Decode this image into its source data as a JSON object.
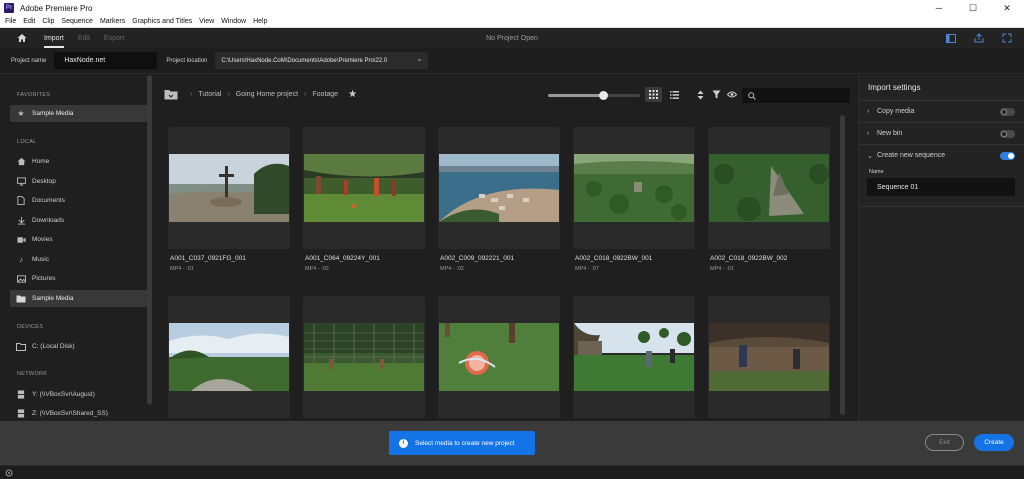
{
  "window": {
    "app_icon": "Pr",
    "title": "Adobe Premiere Pro",
    "controls": [
      "─",
      "☐",
      "✕"
    ]
  },
  "menu": [
    "File",
    "Edit",
    "Clip",
    "Sequence",
    "Markers",
    "Graphics and Titles",
    "View",
    "Window",
    "Help"
  ],
  "header": {
    "tabs": [
      "Import",
      "Edit",
      "Export"
    ],
    "active_tab": "Import",
    "status": "No Project Open"
  },
  "project": {
    "name_label": "Project name",
    "name_value": "HaxNode.net",
    "location_label": "Project location",
    "location_value": "C:\\Users\\HaxNode.CoM\\Documents\\Adobe\\Premiere Pro\\22.0"
  },
  "sidebar": {
    "favorites_heading": "FAVORITES",
    "favorites": [
      {
        "label": "Sample Media",
        "icon": "star-icon"
      }
    ],
    "local_heading": "LOCAL",
    "local": [
      {
        "label": "Home",
        "icon": "home-icon"
      },
      {
        "label": "Desktop",
        "icon": "desktop-icon"
      },
      {
        "label": "Documents",
        "icon": "document-icon"
      },
      {
        "label": "Downloads",
        "icon": "download-icon"
      },
      {
        "label": "Movies",
        "icon": "movie-icon"
      },
      {
        "label": "Music",
        "icon": "music-icon"
      },
      {
        "label": "Pictures",
        "icon": "picture-icon"
      },
      {
        "label": "Sample Media",
        "icon": "folder-icon"
      }
    ],
    "devices_heading": "DEVICES",
    "devices": [
      {
        "label": "C: (Local Disk)",
        "icon": "folder-icon"
      }
    ],
    "network_heading": "NETWORK",
    "network": [
      {
        "label": "Y: (\\\\VBoxSvr\\August)",
        "icon": "network-drive-icon"
      },
      {
        "label": "Z: (\\\\VBoxSvr\\Shared_SS)",
        "icon": "network-drive-icon"
      }
    ]
  },
  "browser": {
    "breadcrumb": [
      "Tutorial",
      "Going Home project",
      "Footage"
    ],
    "search_placeholder": "",
    "thumbnail_size_level": 0.6,
    "clips": [
      {
        "name": "A001_C037_0921FG_001",
        "meta": "MP4 - :01"
      },
      {
        "name": "A001_C064_09224Y_001",
        "meta": "MP4 - :02"
      },
      {
        "name": "A002_C009_092221_001",
        "meta": "MP4 - :02"
      },
      {
        "name": "A002_C018_0922BW_001",
        "meta": "MP4 - :07"
      },
      {
        "name": "A002_C018_0922BW_002",
        "meta": "MP4 - :01"
      },
      {
        "name": "",
        "meta": ""
      },
      {
        "name": "",
        "meta": ""
      },
      {
        "name": "",
        "meta": ""
      },
      {
        "name": "",
        "meta": ""
      },
      {
        "name": "",
        "meta": ""
      }
    ]
  },
  "import_settings": {
    "title": "Import settings",
    "copy_media": {
      "label": "Copy media",
      "on": false
    },
    "new_bin": {
      "label": "New bin",
      "on": false
    },
    "create_sequence": {
      "label": "Create new sequence",
      "on": true
    },
    "name_label": "Name",
    "name_value": "Sequence 01"
  },
  "footer": {
    "notice": "Select media to create new project",
    "exit_label": "Exit",
    "create_label": "Create"
  },
  "colors": {
    "accent": "#1473e6"
  }
}
